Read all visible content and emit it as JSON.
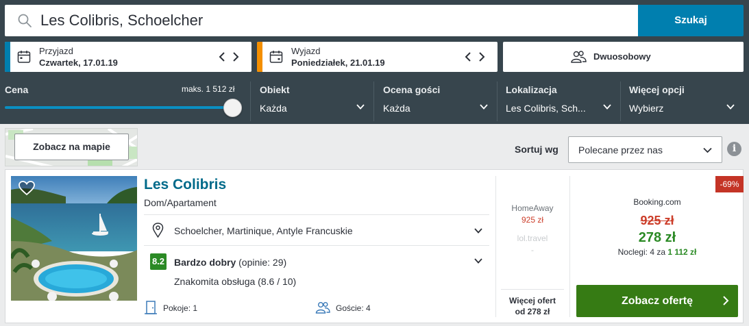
{
  "search": {
    "query": "Les Colibris, Schoelcher",
    "button_label": "Szukaj"
  },
  "checkin": {
    "label": "Przyjazd",
    "date": "Czwartek, 17.01.19",
    "accent": "#007faf"
  },
  "checkout": {
    "label": "Wyjazd",
    "date": "Poniedziałek, 21.01.19",
    "accent": "#f48f00"
  },
  "room": {
    "label": "Dwuosobowy"
  },
  "filters": {
    "price": {
      "label": "Cena",
      "max_label": "maks. 1 512 zł",
      "level_percent": 100
    },
    "object": {
      "label": "Obiekt",
      "value": "Każda"
    },
    "rating": {
      "label": "Ocena gości",
      "value": "Każda"
    },
    "location": {
      "label": "Lokalizacja",
      "value": "Les Colibris, Sch..."
    },
    "more": {
      "label": "Więcej opcji",
      "value": "Wybierz"
    }
  },
  "map": {
    "button_label": "Zobacz na mapie"
  },
  "sort": {
    "label": "Sortuj wg",
    "value": "Polecane przez nas"
  },
  "hotel": {
    "name": "Les Colibris",
    "type": "Dom/Apartament",
    "location": "Schoelcher, Martinique, Antyle Francuskie",
    "rating_score": "8.2",
    "rating_label": "Bardzo dobry",
    "rating_reviews": " (opinie: 29)",
    "service": "Znakomita obsługa (8.6 / 10)",
    "rooms": "Pokoje: 1",
    "guests": "Goście: 4",
    "partners": [
      {
        "name": "HomeAway",
        "price": "925 zł"
      },
      {
        "name": "lol.travel",
        "price": "-"
      }
    ],
    "more_offers_line1": "Więcej ofert",
    "more_offers_line2": "od 278 zł",
    "deal": {
      "discount": "-69%",
      "site": "Booking.com",
      "old_price": "925 zł",
      "new_price": "278 zł",
      "nights_prefix": "Noclegi: 4 za ",
      "nights_total": "1 112 zł",
      "button_label": "Zobacz ofertę"
    }
  },
  "colors": {
    "topbar": "#37454d",
    "primary_blue": "#007faf",
    "deal_green": "#367b14",
    "rating_green": "#2b8a25",
    "price_red": "#cc3d29",
    "hotel_name": "#006a8a"
  }
}
